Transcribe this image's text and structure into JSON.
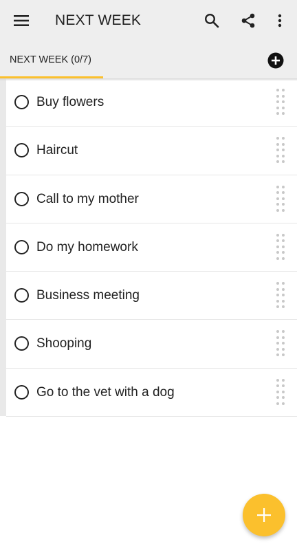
{
  "appbar": {
    "title": "NEXT WEEK",
    "icons": [
      "menu-icon",
      "search-icon",
      "share-icon",
      "more-vert-icon"
    ]
  },
  "tabs": [
    {
      "label": "NEXT WEEK (0/7)",
      "selected": true
    }
  ],
  "colors": {
    "accent": "#fbc02d",
    "appbar_bg": "#eeeeee"
  },
  "tasks": [
    {
      "label": "Buy flowers",
      "done": false
    },
    {
      "label": "Haircut",
      "done": false
    },
    {
      "label": "Call to my mother",
      "done": false
    },
    {
      "label": "Do my homework",
      "done": false
    },
    {
      "label": "Business meeting",
      "done": false
    },
    {
      "label": "Shooping",
      "done": false
    },
    {
      "label": "Go to the vet with a dog",
      "done": false
    }
  ],
  "fab": {
    "icon": "plus-icon"
  }
}
